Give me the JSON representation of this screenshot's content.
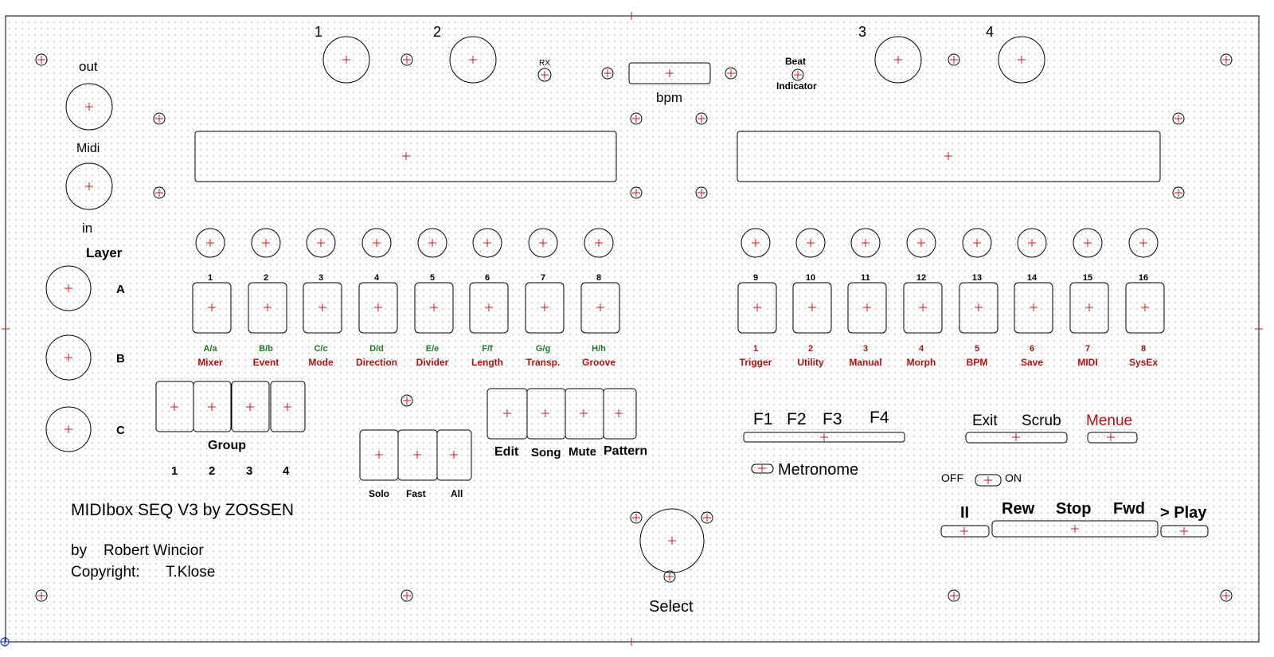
{
  "colors": {
    "line": "#000000",
    "marker": "#d01818",
    "label_green": "#1e7a1e",
    "label_red": "#b01010",
    "grid": "#9a9a9a"
  },
  "encoders": {
    "n1": "1",
    "n2": "2",
    "n3": "3",
    "n4": "4"
  },
  "leds_top": {
    "rx": "RX",
    "bpm": "bpm",
    "beat": "Beat",
    "indicator": "Indicator"
  },
  "midi": {
    "out": "out",
    "midi": "Midi",
    "in": "in"
  },
  "layer": {
    "title": "Layer",
    "a": "A",
    "b": "B",
    "c": "C"
  },
  "tracks": [
    {
      "num": "1",
      "letter": "A/a",
      "func": "Mixer"
    },
    {
      "num": "2",
      "letter": "B/b",
      "func": "Event"
    },
    {
      "num": "3",
      "letter": "C/c",
      "func": "Mode"
    },
    {
      "num": "4",
      "letter": "D/d",
      "func": "Direction"
    },
    {
      "num": "5",
      "letter": "E/e",
      "func": "Divider"
    },
    {
      "num": "6",
      "letter": "F/f",
      "func": "Length"
    },
    {
      "num": "7",
      "letter": "G/g",
      "func": "Transp."
    },
    {
      "num": "8",
      "letter": "H/h",
      "func": "Groove"
    },
    {
      "num": "9",
      "letter": "1",
      "func": "Trigger"
    },
    {
      "num": "10",
      "letter": "2",
      "func": "Utility"
    },
    {
      "num": "11",
      "letter": "3",
      "func": "Manual"
    },
    {
      "num": "12",
      "letter": "4",
      "func": "Morph"
    },
    {
      "num": "13",
      "letter": "5",
      "func": "BPM"
    },
    {
      "num": "14",
      "letter": "6",
      "func": "Save"
    },
    {
      "num": "15",
      "letter": "7",
      "func": "MIDI"
    },
    {
      "num": "16",
      "letter": "8",
      "func": "SysEx"
    }
  ],
  "group": {
    "title": "Group",
    "nums": [
      "1",
      "2",
      "3",
      "4"
    ]
  },
  "small_buttons": {
    "solo": "Solo",
    "fast": "Fast",
    "all": "All"
  },
  "mode_buttons": {
    "edit": "Edit",
    "song": "Song",
    "mute": "Mute",
    "pattern": "Pattern"
  },
  "fkeys": {
    "f1": "F1",
    "f2": "F2",
    "f3": "F3",
    "f4": "F4",
    "metronome": "Metronome"
  },
  "right_buttons": {
    "exit": "Exit",
    "scrub": "Scrub",
    "menue": "Menue",
    "off": "OFF",
    "on": "ON"
  },
  "transport": {
    "pause": "II",
    "rew": "Rew",
    "stop": "Stop",
    "fwd": "Fwd",
    "play": "> Play"
  },
  "select": "Select",
  "credits": {
    "title": "MIDIbox SEQ V3 by ZOSSEN",
    "by": "by",
    "author": "Robert Wincior",
    "copyright_label": "Copyright:",
    "copyright_name": "T.Klose"
  }
}
